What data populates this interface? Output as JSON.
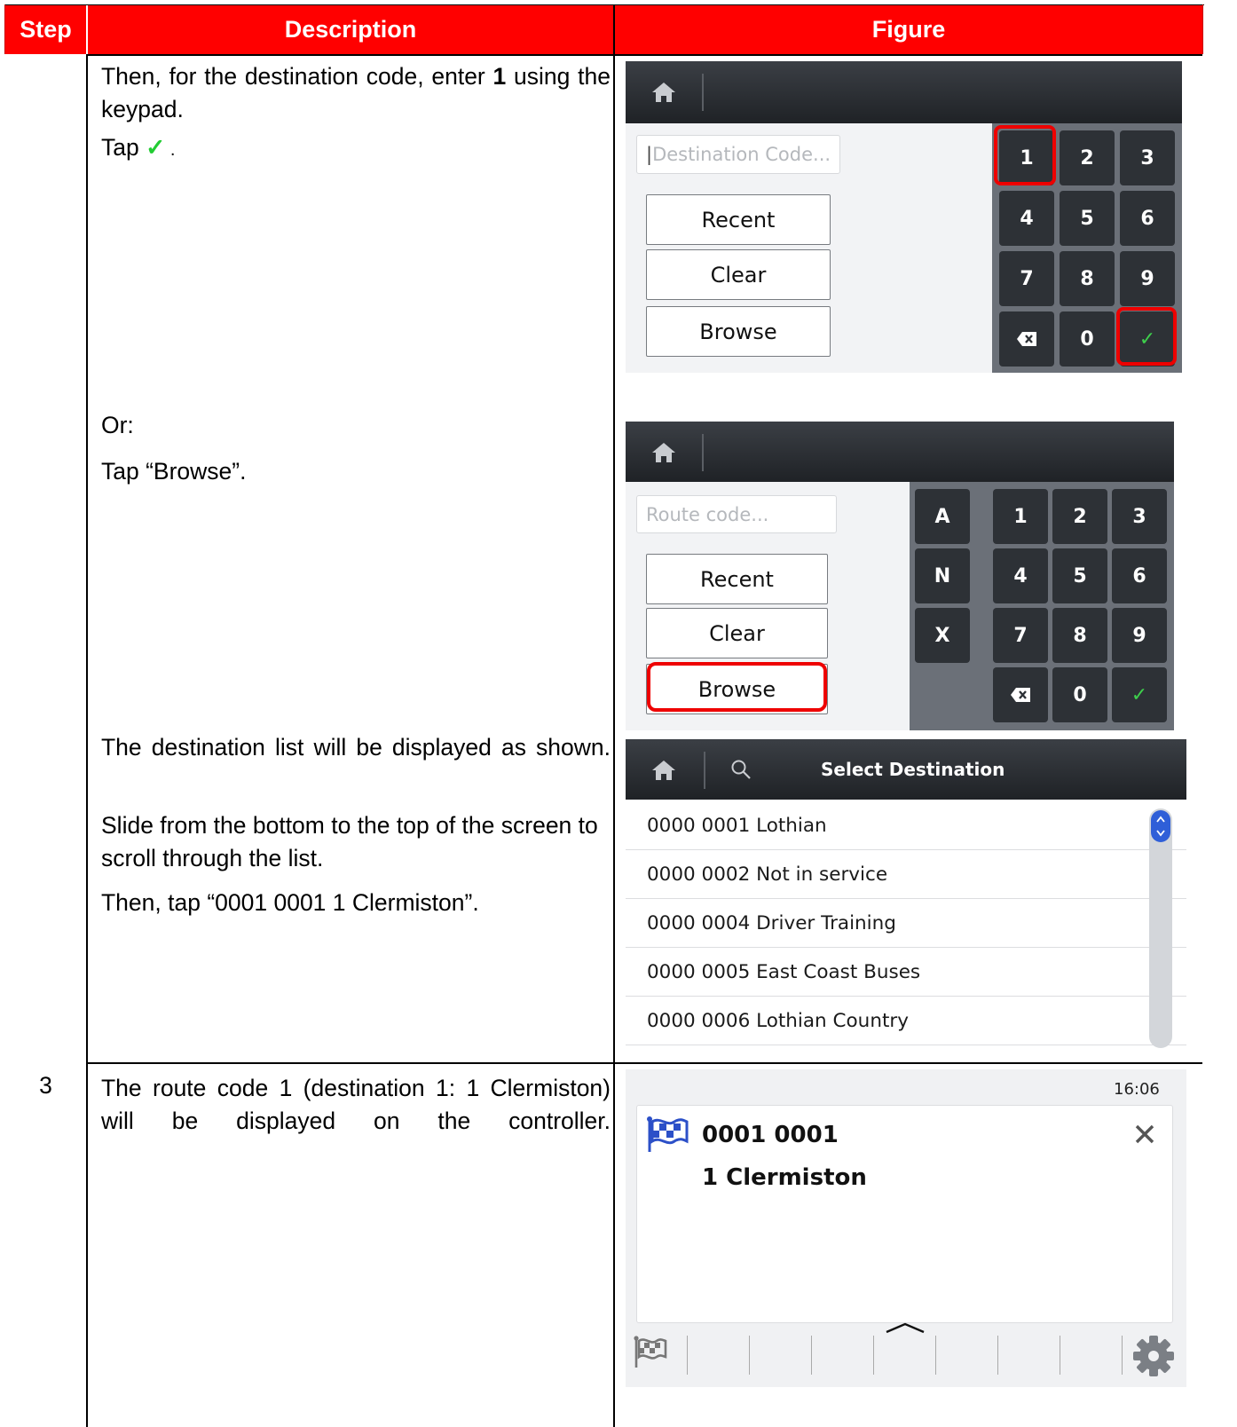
{
  "header": {
    "step": "Step",
    "description": "Description",
    "figure": "Figure"
  },
  "row1": {
    "p1_a": "Then, for the destination code, enter ",
    "p1_bold": "1",
    "p1_b": " using the keypad.",
    "p2_tap": "Tap ",
    "p2_check": "✓",
    "p2_dot": " .",
    "p3": "Or:",
    "p4": "Tap “Browse”.",
    "p5": "The destination list will be displayed as shown.",
    "p6": "Slide from the bottom to the top of the screen to scroll through the list.",
    "p7": "Then, tap “0001 0001 1 Clermiston”."
  },
  "row2": {
    "step": "3",
    "desc": "The route code 1 (destination 1: 1 Clermiston) will be displayed on the controller."
  },
  "shot1": {
    "placeholder": "Destination Code...",
    "buttons": [
      "Recent",
      "Clear",
      "Browse"
    ],
    "keys": [
      "1",
      "2",
      "3",
      "4",
      "5",
      "6",
      "7",
      "8",
      "9",
      "⌫",
      "0",
      "✓"
    ]
  },
  "shot2": {
    "placeholder": "Route code...",
    "buttons": [
      "Recent",
      "Clear",
      "Browse"
    ],
    "letter_keys": [
      "A",
      "N",
      "X"
    ],
    "keys": [
      "1",
      "2",
      "3",
      "4",
      "5",
      "6",
      "7",
      "8",
      "9",
      "⌫",
      "0",
      "✓"
    ]
  },
  "shot3": {
    "title": "Select Destination",
    "items": [
      "0000 0001 Lothian",
      "0000 0002 Not in service",
      "0000 0004 Driver Training",
      "0000 0005 East Coast Buses",
      "0000 0006 Lothian Country"
    ]
  },
  "shot4": {
    "time": "16:06",
    "code": "0001 0001",
    "name": "1 Clermiston"
  },
  "colors": {
    "header_bg": "#ff0000",
    "check_green": "#22cc33",
    "highlight_red": "#ee0000",
    "scroll_blue": "#2f5fd8"
  },
  "icons": [
    "home-icon",
    "search-icon",
    "backspace-icon",
    "check-icon",
    "flag-icon",
    "close-icon",
    "gear-icon",
    "chevron-up-icon"
  ]
}
